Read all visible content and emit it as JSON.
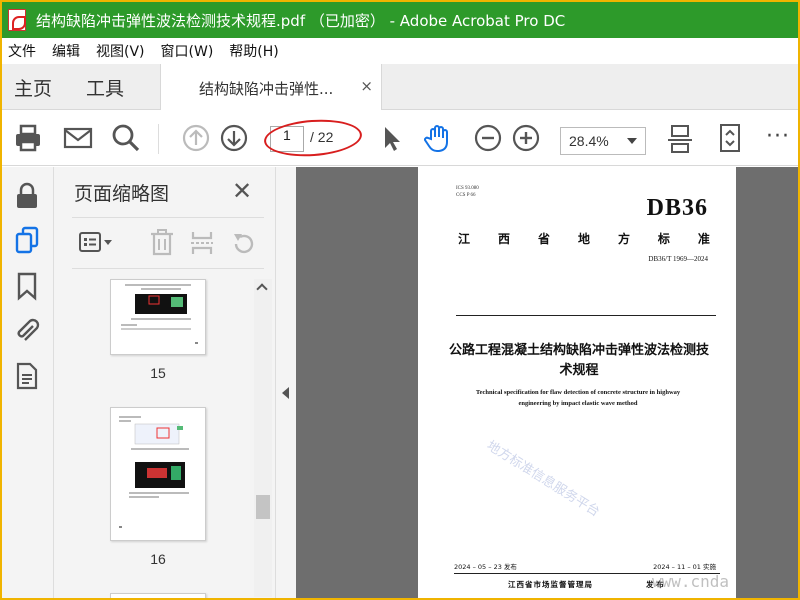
{
  "window": {
    "title": "结构缺陷冲击弹性波法检测技术规程.pdf （已加密） - Adobe Acrobat Pro DC"
  },
  "menu": [
    "文件",
    "编辑",
    "视图(V)",
    "窗口(W)",
    "帮助(H)"
  ],
  "tabs": {
    "home": "主页",
    "tools": "工具",
    "document": "结构缺陷冲击弹性...",
    "close": "×"
  },
  "toolbar": {
    "current_page": "1",
    "total_pages": "/ 22",
    "zoom": "28.4%",
    "more": "···"
  },
  "thumbnail_panel": {
    "title": "页面缩略图",
    "close": "✕",
    "pages": [
      {
        "label": "15"
      },
      {
        "label": "16"
      }
    ]
  },
  "document": {
    "ics": "ICS 93.080",
    "ccs": "CCS P 66",
    "code": "DB36",
    "province": [
      "江",
      "西",
      "省",
      "地",
      "方",
      "标",
      "准"
    ],
    "standard_number": "DB36/T 1969—2024",
    "title_cn": "公路工程混凝土结构缺陷冲击弹性波法检测技术规程",
    "title_en": "Technical specification for flaw detection of concrete structure in highway engineering by impact elastic wave method",
    "watermark": "地方标准信息服务平台",
    "publish_date": "2024 – 05 – 23 发布",
    "implement_date": "2024 – 11 – 01 实施",
    "issuer": "江西省市场监督管理局",
    "issue_word": "发 布"
  },
  "site_watermark": "www.cnda",
  "colors": {
    "titlebar": "#2d9a2a",
    "highlight_ellipse": "#d81e1e",
    "doc_background": "#6e6e6e",
    "active_icon": "#1473e6"
  }
}
